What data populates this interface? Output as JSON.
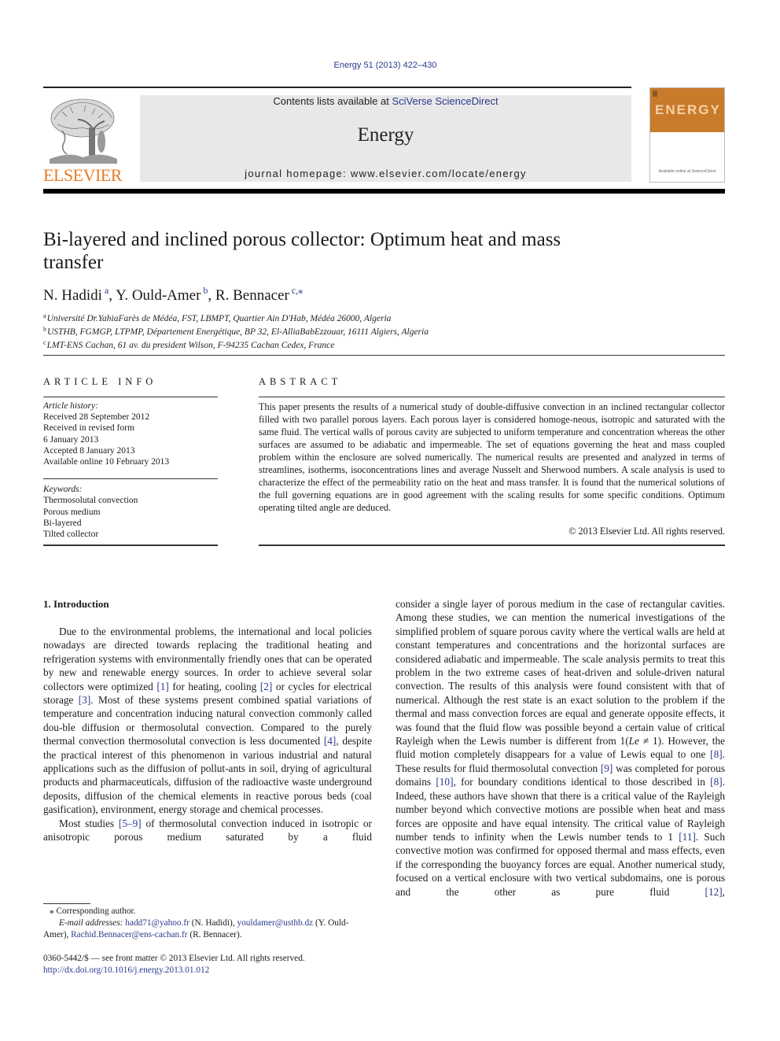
{
  "citation": "Energy 51 (2013) 422–430",
  "header": {
    "contents_prefix": "Contents lists available at ",
    "contents_link": "SciVerse ScienceDirect",
    "journal_name": "Energy",
    "homepage_label": "journal homepage: ",
    "homepage_url": "www.elsevier.com/locate/energy",
    "publisher_wordmark": "ELSEVIER",
    "cover_title": "ENERGY",
    "cover_footer": "Available online at ScienceDirect",
    "colors": {
      "publisher_orange": "#e87b24",
      "cover_orange": "#c97b2c",
      "link_blue": "#2b3a8c"
    }
  },
  "article": {
    "title_line1": "Bi-layered and inclined porous collector: Optimum heat and mass",
    "title_line2": "transfer",
    "authors": [
      {
        "name": "N. Hadidi",
        "sup": "a",
        "sep": ", "
      },
      {
        "name": "Y. Ould-Amer",
        "sup": "b",
        "sep": ", "
      },
      {
        "name": "R. Bennacer",
        "sup": "c,⁎",
        "sep": ""
      }
    ],
    "affiliations": [
      {
        "key": "a",
        "text": "Université Dr.YahiaFarès de Médéa, FST, LBMPT, Quartier Ain D'Hab, Médéa 26000, Algeria"
      },
      {
        "key": "b",
        "text": "USTHB, FGMGP, LTPMP, Département Energétique, BP 32, El-AlliaBabEzzouar, 16111 Algiers, Algeria"
      },
      {
        "key": "c",
        "text": "LMT-ENS Cachan, 61 av. du president Wilson, F-94235 Cachan Cedex, France"
      }
    ]
  },
  "article_info": {
    "heading": "ARTICLE INFO",
    "history_label": "Article history:",
    "history": [
      "Received 28 September 2012",
      "Received in revised form",
      "6 January 2013",
      "Accepted 8 January 2013",
      "Available online 10 February 2013"
    ],
    "keywords_label": "Keywords:",
    "keywords": [
      "Thermosolutal convection",
      "Porous medium",
      "Bi-layered",
      "Tilted collector"
    ]
  },
  "abstract": {
    "heading": "ABSTRACT",
    "text": "This paper presents the results of a numerical study of double-diffusive convection in an inclined rectangular collector filled with two parallel porous layers. Each porous layer is considered homoge-neous, isotropic and saturated with the same fluid. The vertical walls of porous cavity are subjected to uniform temperature and concentration whereas the other surfaces are assumed to be adiabatic and impermeable. The set of equations governing the heat and mass coupled problem within the enclosure are solved numerically. The numerical results are presented and analyzed in terms of streamlines, isotherms, isoconcentrations lines and average Nusselt and Sherwood numbers. A scale analysis is used to characterize the effect of the permeability ratio on the heat and mass transfer. It is found that the numerical solutions of the full governing equations are in good agreement with the scaling results for some specific conditions. Optimum operating tilted angle are deduced.",
    "copyright": "© 2013 Elsevier Ltd. All rights reserved."
  },
  "body": {
    "section1_heading": "1.  Introduction",
    "left_p1": [
      "Due to the environmental problems, the international and local policies nowadays are directed towards replacing the traditional heating and refrigeration systems with environmentally friendly ones that can be operated by new and renewable energy sources. In order to achieve several solar collectors were optimized ",
      "[1]",
      " for heating, cooling ",
      "[2]",
      " or cycles for electrical storage ",
      "[3]",
      ". Most of these systems present combined spatial variations of temperature and concentration inducing natural convection commonly called dou-ble diffusion or thermosolutal convection. Compared to the purely thermal convection thermosolutal convection is less documented ",
      "[4]",
      ", despite the practical interest of this phenomenon in various industrial and natural applications such as the diffusion of pollut-ants in soil, drying of agricultural products and pharmaceuticals, diffusion of the radioactive waste underground deposits, diffusion of the chemical elements in reactive porous beds (coal gasification), environment, energy storage and chemical processes."
    ],
    "left_p2": [
      "Most studies ",
      "[5–9]",
      " of thermosolutal convection induced in isotropic or anisotropic porous medium saturated by a fluid"
    ],
    "right": [
      "consider a single layer of porous medium in the case of rectangular cavities. Among these studies, we can mention the numerical investigations of the simplified problem of square porous cavity where the vertical walls are held at constant temperatures and concentrations and the horizontal surfaces are considered adiabatic and impermeable. The scale analysis permits to treat this problem in the two extreme cases of heat-driven and solule-driven natural convection. The results of this analysis were found consistent with that of numerical. Although the rest state is an exact solution to the problem if the thermal and mass convection forces are equal and generate opposite effects, it was found that the fluid flow was possible beyond a certain value of critical Rayleigh when the Lewis number is different from 1(",
      "Le",
      " ≠ 1). However, the fluid motion completely disappears for a value of Lewis equal to one ",
      "[8]",
      ". These results for fluid thermosolutal convection ",
      "[9]",
      " was completed for porous domains ",
      "[10]",
      ", for boundary conditions identical to those described in ",
      "[8]",
      ". Indeed, these authors have shown that there is a critical value of the Rayleigh number beyond which convective motions are possible when heat and mass forces are opposite and have equal intensity. The critical value of Rayleigh number tends to infinity when the Lewis number tends to 1 ",
      "[11]",
      ". Such convective motion was confirmed for opposed thermal and mass effects, even if the corresponding the buoyancy forces are equal. Another numerical study, focused on a vertical enclosure with two vertical subdomains, one is porous and the other as pure fluid ",
      "[12]",
      ","
    ]
  },
  "footnotes": {
    "corresponding": "⁎ Corresponding author.",
    "email_label": "E-mail addresses: ",
    "emails": [
      {
        "addr": "hadd71@yahoo.fr",
        "who": " (N. Hadidi), "
      },
      {
        "addr": "youldamer@usthb.dz",
        "who": " (Y. Ould-Amer), "
      },
      {
        "addr": "Rachid.Bennacer@ens-cachan.fr",
        "who": " (R. Bennacer)."
      }
    ],
    "front_matter": "0360-5442/$ — see front matter © 2013 Elsevier Ltd. All rights reserved.",
    "doi": "http://dx.doi.org/10.1016/j.energy.2013.01.012"
  }
}
